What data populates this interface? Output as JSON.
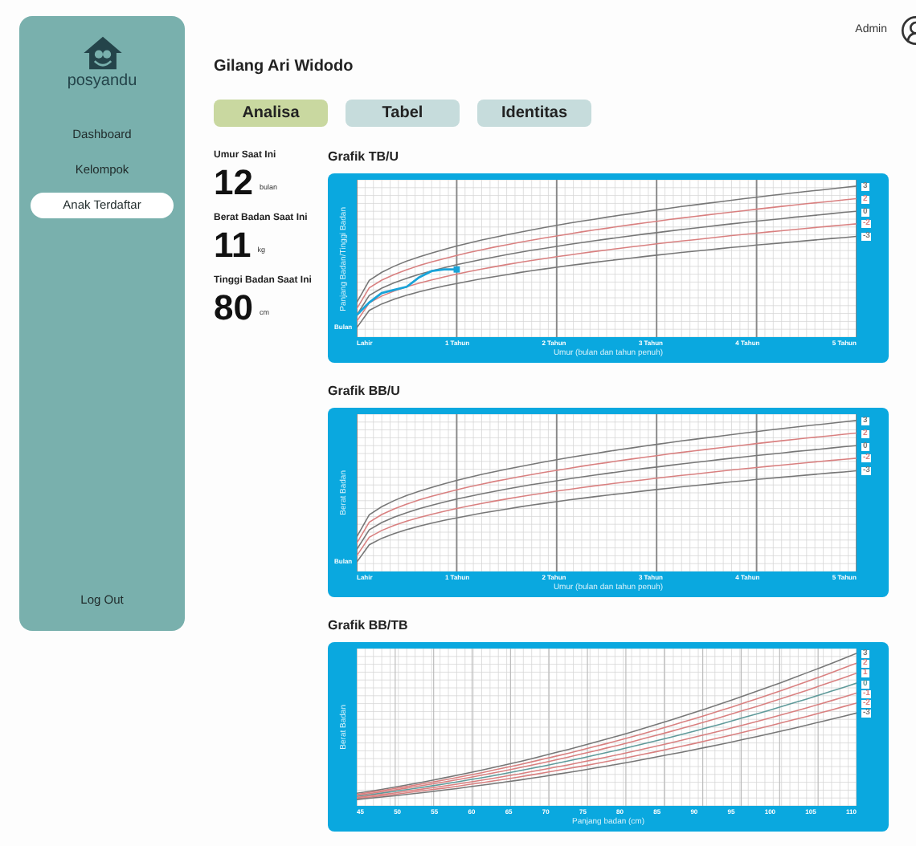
{
  "sidebar": {
    "brand": "posyandu",
    "items": [
      {
        "label": "Dashboard",
        "selected": false
      },
      {
        "label": "Kelompok",
        "selected": false
      },
      {
        "label": "Anak Terdaftar",
        "selected": true
      }
    ],
    "logout": "Log Out"
  },
  "header": {
    "user": "Admin"
  },
  "title": "Gilang Ari Widodo",
  "tabs": [
    {
      "label": "Analisa",
      "selected": true
    },
    {
      "label": "Tabel",
      "selected": false
    },
    {
      "label": "Identitas",
      "selected": false
    }
  ],
  "stats": [
    {
      "label": "Umur Saat Ini",
      "value": "12",
      "unit": "bulan"
    },
    {
      "label": "Berat Badan Saat Ini",
      "value": "11",
      "unit": "kg"
    },
    {
      "label": "Tinggi Badan Saat Ini",
      "value": "80",
      "unit": "cm"
    }
  ],
  "charts": [
    {
      "title": "Grafik TB/U",
      "kind": "age",
      "ylabel": "Panjang Badan/Tinggi Badan",
      "xlabel": "Umur (bulan dan tahun penuh)",
      "corner": "Bulan",
      "child_plot": true,
      "x_labels": [
        "Lahir",
        "1 Tahun",
        "2 Tahun",
        "3 Tahun",
        "4 Tahun",
        "5 Tahun"
      ],
      "curves": [
        {
          "label": "3",
          "color": "#777777"
        },
        {
          "label": "2",
          "color": "#d98080"
        },
        {
          "label": "0",
          "color": "#777777"
        },
        {
          "label": "-2",
          "color": "#d98080"
        },
        {
          "label": "-3",
          "color": "#777777"
        }
      ]
    },
    {
      "title": "Grafik BB/U",
      "kind": "age",
      "ylabel": "Berat Badan",
      "xlabel": "Umur (bulan dan tahun penuh)",
      "corner": "Bulan",
      "child_plot": false,
      "x_labels": [
        "Lahir",
        "1 Tahun",
        "2 Tahun",
        "3 Tahun",
        "4 Tahun",
        "5 Tahun"
      ],
      "curves": [
        {
          "label": "3",
          "color": "#777777"
        },
        {
          "label": "2",
          "color": "#d98080"
        },
        {
          "label": "0",
          "color": "#777777"
        },
        {
          "label": "-2",
          "color": "#d98080"
        },
        {
          "label": "-3",
          "color": "#777777"
        }
      ]
    },
    {
      "title": "Grafik BB/TB",
      "kind": "length",
      "ylabel": "Berat Badan",
      "xlabel": "Panjang badan (cm)",
      "child_plot": false,
      "x_labels": [
        "45",
        "50",
        "55",
        "60",
        "65",
        "70",
        "75",
        "80",
        "85",
        "90",
        "95",
        "100",
        "105",
        "110"
      ],
      "curves": [
        {
          "label": "3",
          "color": "#777777"
        },
        {
          "label": "2",
          "color": "#d98080"
        },
        {
          "label": "1",
          "color": "#d98080"
        },
        {
          "label": "0",
          "color": "#5f9a9a"
        },
        {
          "label": "-1",
          "color": "#d98080"
        },
        {
          "label": "-2",
          "color": "#d98080"
        },
        {
          "label": "-3",
          "color": "#777777"
        }
      ]
    }
  ]
}
